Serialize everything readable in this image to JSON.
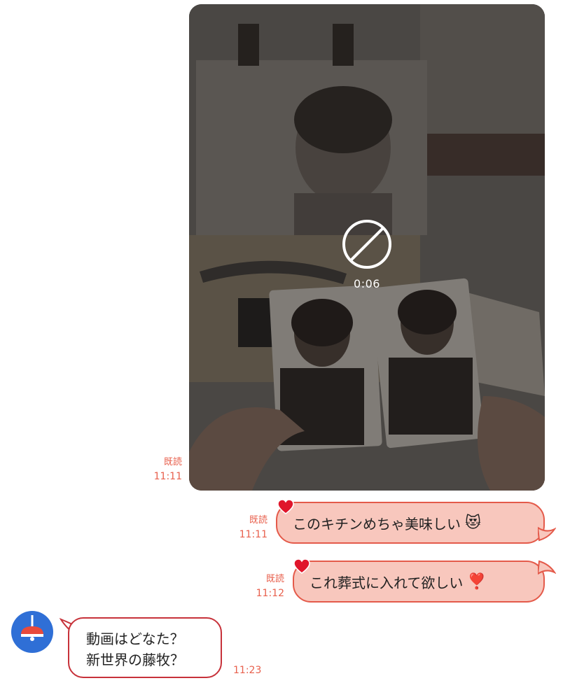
{
  "video_message": {
    "duration": "0:06",
    "status_icon": "prohibited-icon",
    "read_label": "既読",
    "time": "11:11"
  },
  "messages": [
    {
      "direction": "sent",
      "text": "このキチンめちゃ美味しい",
      "emoji": "😻",
      "read_label": "既読",
      "time": "11:11",
      "reaction_icon": "heart-icon"
    },
    {
      "direction": "sent",
      "text": "これ葬式に入れて欲しい",
      "emoji": "❣️",
      "read_label": "既読",
      "time": "11:12",
      "reaction_icon": "heart-icon"
    },
    {
      "direction": "received",
      "lines": [
        "動画はどなた？",
        "新世界の藤牧？"
      ],
      "time": "11:23",
      "avatar_icon": "lamp-icon"
    }
  ],
  "colors": {
    "accent": "#e8604d",
    "sent_bubble_bg": "#f8c7bd",
    "sent_bubble_border": "#e45a4a",
    "received_border": "#c7323a",
    "avatar_bg": "#2f6fd6"
  }
}
